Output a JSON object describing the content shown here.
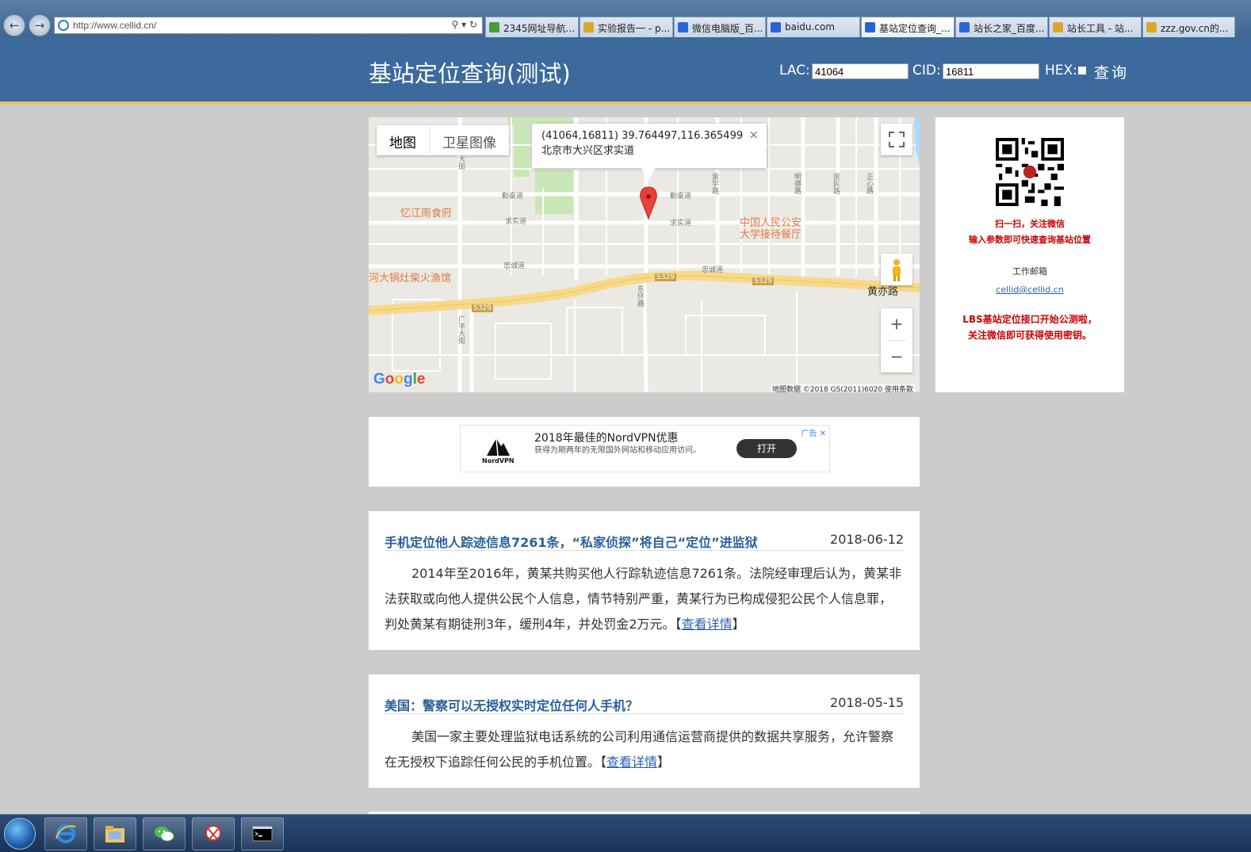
{
  "browser": {
    "url": "http://www.cellid.cn/",
    "tabs": [
      {
        "label": "2345网址导航..."
      },
      {
        "label": "实验报告一 - p..."
      },
      {
        "label": "微信电脑版_百..."
      },
      {
        "label": "baidu.com"
      },
      {
        "label": "基站定位查询_..."
      },
      {
        "label": "站长之家_百度..."
      },
      {
        "label": "站长工具 - 站..."
      },
      {
        "label": "zzz.gov.cn的..."
      }
    ]
  },
  "header": {
    "title": "基站定位查询(测试)",
    "lac_label": "LAC:",
    "lac_value": "41064",
    "cid_label": "CID:",
    "cid_value": "16811",
    "hex_label": "HEX:",
    "query_label": "查询"
  },
  "map": {
    "type_map": "地图",
    "type_satellite": "卫星图像",
    "info_coords": "(41064,16811) 39.764497,116.365499",
    "info_address": "北京市大兴区求实道",
    "close_symbol": "×",
    "zoom_in": "+",
    "zoom_out": "−",
    "credits": "地图数据 ©2018 GS(2011)6020   使用条款",
    "pois": [
      "忆江南食府",
      "河大锅灶柴火渔馆",
      "中国人民公安",
      "大学接待餐厅"
    ],
    "roads": [
      "黄亦路",
      "S329",
      "大街",
      "勤奋道",
      "求实道",
      "忠诚道",
      "东环路",
      "广平大街",
      "雷宇路",
      "明德路",
      "崇民路",
      "正心路",
      "求实道",
      "勤奋道",
      "忠诚道"
    ]
  },
  "side": {
    "scan_line1": "扫一扫，关注微信",
    "scan_line2": "输入参数即可快速查询基站位置",
    "email_label": "工作邮箱",
    "email": "cellid@cellid.cn",
    "promo_line1": "LBS基站定位接口开始公测啦，",
    "promo_line2": "关注微信即可获得使用密钥。"
  },
  "ad": {
    "brand": "NordVPN",
    "title": "2018年最佳的NordVPN优惠",
    "desc": "获得为期两年的无限国外网站和移动应用访问。",
    "button": "打开",
    "tag": "广告"
  },
  "news": [
    {
      "title": "手机定位他人踪迹信息7261条，“私家侦探”将自己“定位”进监狱",
      "date": "2018-06-12",
      "body": "2014年至2016年，黄某共购买他人行踪轨迹信息7261条。法院经审理后认为，黄某非法获取或向他人提供公民个人信息，情节特别严重，黄某行为已构成侵犯公民个人信息罪，判处黄某有期徒刑3年，缓刑4年，并处罚金2万元。",
      "more": "查看详情"
    },
    {
      "title": "美国：警察可以无授权实时定位任何人手机？",
      "date": "2018-05-15",
      "body": "美国一家主要处理监狱电话系统的公司利用通信运营商提供的数据共享服务，允许警察在无授权下追踪任何公民的手机位置。",
      "more": "查看详情"
    }
  ],
  "colors": {
    "header_bg": "#3c6a9c",
    "header_border": "#f0c040",
    "page_bg": "#cccccc",
    "news_title": "#2a5f9c",
    "promo_red": "#cc0000"
  }
}
